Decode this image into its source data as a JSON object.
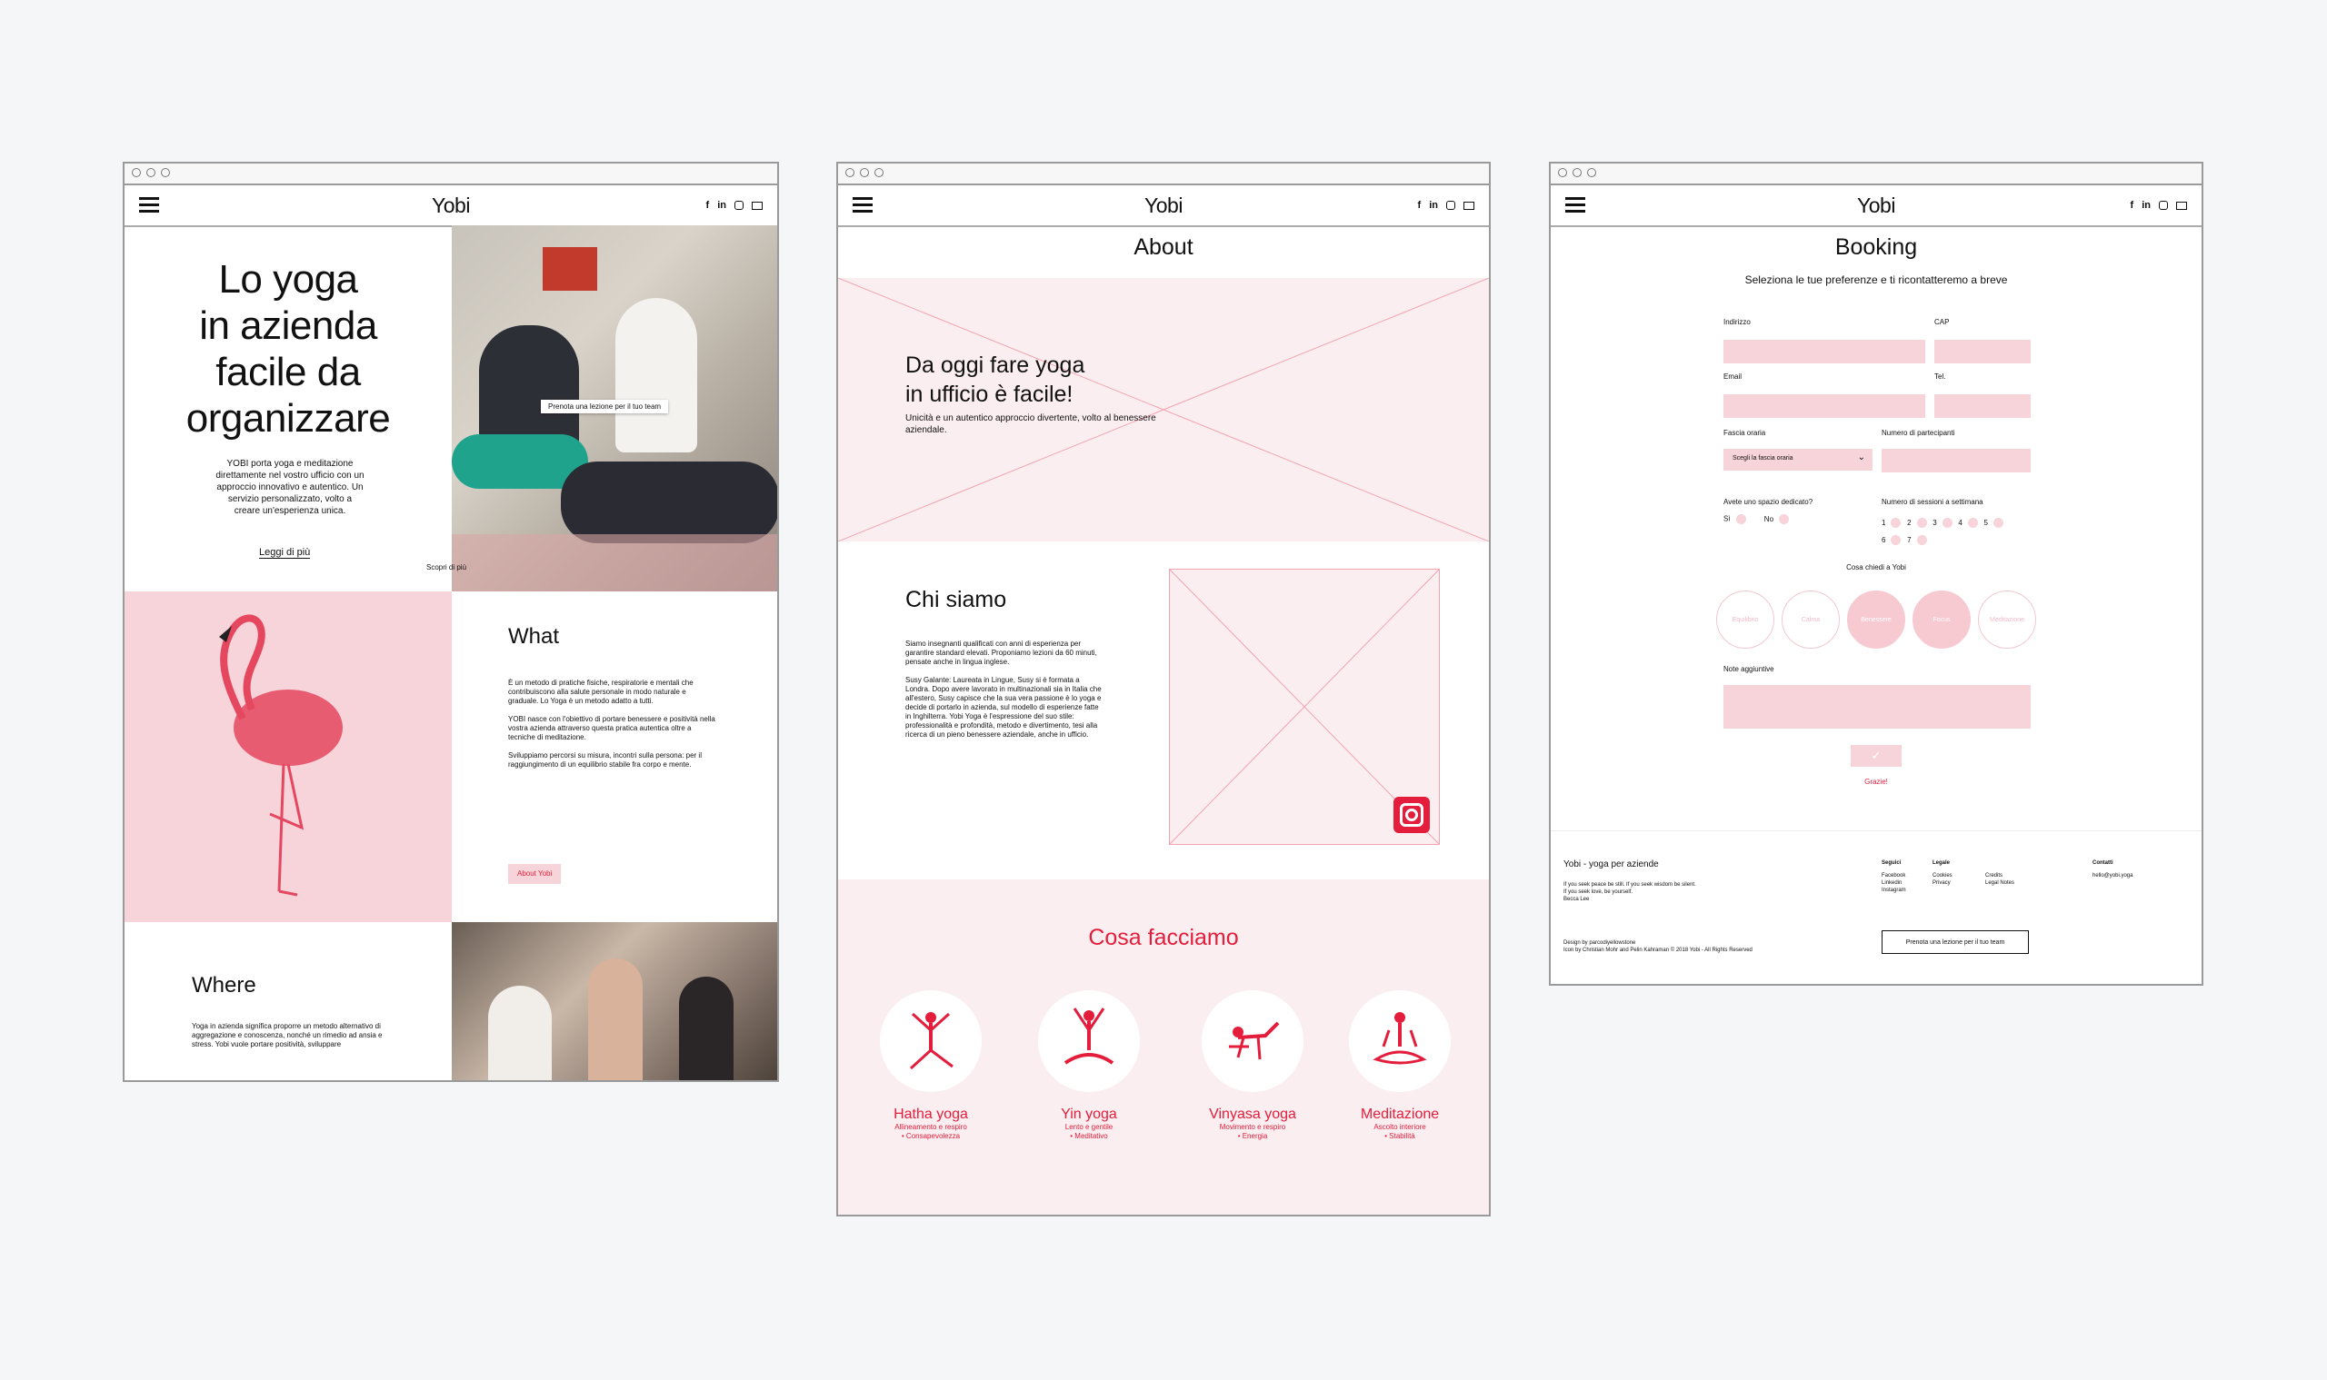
{
  "brand": {
    "logo": "Yobi",
    "social": [
      "f",
      "in"
    ],
    "accent": "#e31d3b",
    "pink": "#f7d4da"
  },
  "home": {
    "hero_title_lines": [
      "Lo yoga",
      "in azienda",
      "facile da",
      "organizzare"
    ],
    "hero_text": "YOBI porta yoga e meditazione direttamente nel vostro ufficio con un approccio innovativo e autentico. Un servizio personalizzato, volto a creare un'esperienza unica.",
    "read_more": "Leggi di più",
    "discover": "Scopri di più",
    "book_tooltip": "Prenota una lezione per il tuo team",
    "what_title": "What",
    "what_p1": "È un metodo di pratiche fisiche, respiratorie e mentali che contribuiscono alla salute personale in modo naturale e graduale. Lo Yoga è un metodo adatto a tutti.",
    "what_p2": "YOBI nasce con l'obiettivo di portare benessere e positività nella vostra azienda attraverso questa pratica autentica oltre a tecniche di meditazione.",
    "what_p3": "Sviluppiamo percorsi su misura, incontri sulla persona: per il raggiungimento di un equilibrio stabile fra corpo e mente.",
    "about_btn": "About Yobi",
    "where_title": "Where",
    "where_text": "Yoga in azienda significa proporre un metodo alternativo di aggregazione e conoscenza, nonché un rimedio ad ansia e stress. Yobi vuole portare positività, sviluppare"
  },
  "about": {
    "title": "About",
    "hero_lines": [
      "Da oggi fare yoga",
      "in ufficio è facile!"
    ],
    "hero_sub": "Unicità e un autentico approccio divertente, volto al benessere aziendale.",
    "who_title": "Chi siamo",
    "who_p1": "Siamo insegnanti qualificati con anni di esperienza per garantire standard elevati. Proponiamo lezioni da 60 minuti, pensate anche in lingua inglese.",
    "who_p2": "Susy Galante: Laureata in Lingue, Susy si è formata a Londra. Dopo avere lavorato in multinazionali sia in Italia che all'estero, Susy capisce che la sua vera passione è lo yoga e decide di portarlo in azienda, sul modello di esperienze fatte in Inghilterra. Yobi Yoga è l'espressione del suo stile: professionalità e profondità, metodo e divertimento, tesi alla ricerca di un pieno benessere aziendale, anche in ufficio.",
    "what_we_do": "Cosa facciamo",
    "services": [
      {
        "name": "Hatha yoga",
        "l1": "Allineamento e respiro",
        "l2": "• Consapevolezza"
      },
      {
        "name": "Yin yoga",
        "l1": "Lento e gentile",
        "l2": "• Meditativo"
      },
      {
        "name": "Vinyasa yoga",
        "l1": "Movimento e respiro",
        "l2": "• Energia"
      },
      {
        "name": "Meditazione",
        "l1": "Ascolto interiore",
        "l2": "• Stabilità"
      }
    ]
  },
  "booking": {
    "title": "Booking",
    "subtitle": "Seleziona le tue preferenze e ti ricontatteremo a breve",
    "labels": {
      "address": "Indirizzo",
      "cap": "CAP",
      "email": "Email",
      "tel": "Tel.",
      "slot": "Fascia oraria",
      "participants": "Numero di partecipanti",
      "space": "Avete uno spazio dedicato?",
      "sessions": "Numero di sessioni a settimana",
      "ask": "Cosa chiedi a Yobi",
      "notes": "Note aggiuntive"
    },
    "slot_placeholder": "Scegli la fascia oraria",
    "yes": "Sì",
    "no": "No",
    "sessions": [
      "1",
      "2",
      "3",
      "4",
      "5",
      "6",
      "7"
    ],
    "asks": [
      "Equilibrio",
      "Calma",
      "Benessere",
      "Focus",
      "Meditazione"
    ],
    "submit_icon": "check-icon",
    "thanks": "Grazie!",
    "footer": {
      "title": "Yobi - yoga per aziende",
      "quote": [
        "If you seek peace be still. If you seek wisdom be silent.",
        "If you seek love, be yourself.",
        "Becca Lee"
      ],
      "follow_h": "Seguici",
      "follow": [
        "Facebook",
        "Linkedin",
        "Instagram"
      ],
      "legal_h": "Legale",
      "legal1": [
        "Cookies",
        "Privacy"
      ],
      "legal2": [
        "Credits",
        "Legal Notes"
      ],
      "contact_h": "Contatti",
      "email": "hello@yobi.yoga",
      "credits": [
        "Design by parcodiyellowstone",
        "Icon by Christian Mohr and Pelin Kahraman © 2018 Yobi - All Rights Reserved"
      ],
      "cta": "Prenota una lezione per il tuo team"
    }
  }
}
